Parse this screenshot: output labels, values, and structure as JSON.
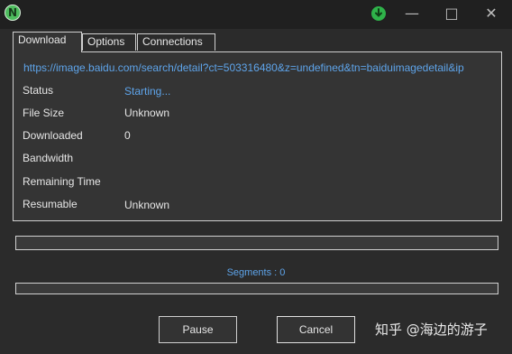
{
  "titlebar": {
    "app_icon": "n-logo-icon",
    "app_icon_letter": "N",
    "download_indicator_icon": "green-download-icon",
    "minimize_glyph": "—",
    "maximize_glyph": "□",
    "close_glyph": "✕"
  },
  "tabs": [
    {
      "label": "Download",
      "active": true
    },
    {
      "label": "Options",
      "active": false
    },
    {
      "label": "Connections",
      "active": false
    }
  ],
  "download": {
    "url": "https://image.baidu.com/search/detail?ct=503316480&z=undefined&tn=baiduimagedetail&ip",
    "rows": [
      {
        "label": "Status",
        "value": "Starting..."
      },
      {
        "label": "File Size",
        "value": "Unknown"
      },
      {
        "label": "Downloaded",
        "value": "0"
      },
      {
        "label": "Bandwidth",
        "value": ""
      },
      {
        "label": "Remaining Time",
        "value": ""
      },
      {
        "label": "Resumable",
        "value": "Unknown"
      }
    ]
  },
  "progress": {
    "main_fraction": 0,
    "segments_fraction": 0,
    "segments_text": "Segments : 0"
  },
  "buttons": {
    "pause_label": "Pause",
    "cancel_label": "Cancel"
  },
  "watermark": "知乎 @海边的游子",
  "colors": {
    "accent_link": "#5ea4ea",
    "app_icon_green": "#4ebd5e",
    "download_green": "#2fb34a",
    "background": "#2b2b2b",
    "titlebar": "#202020"
  }
}
